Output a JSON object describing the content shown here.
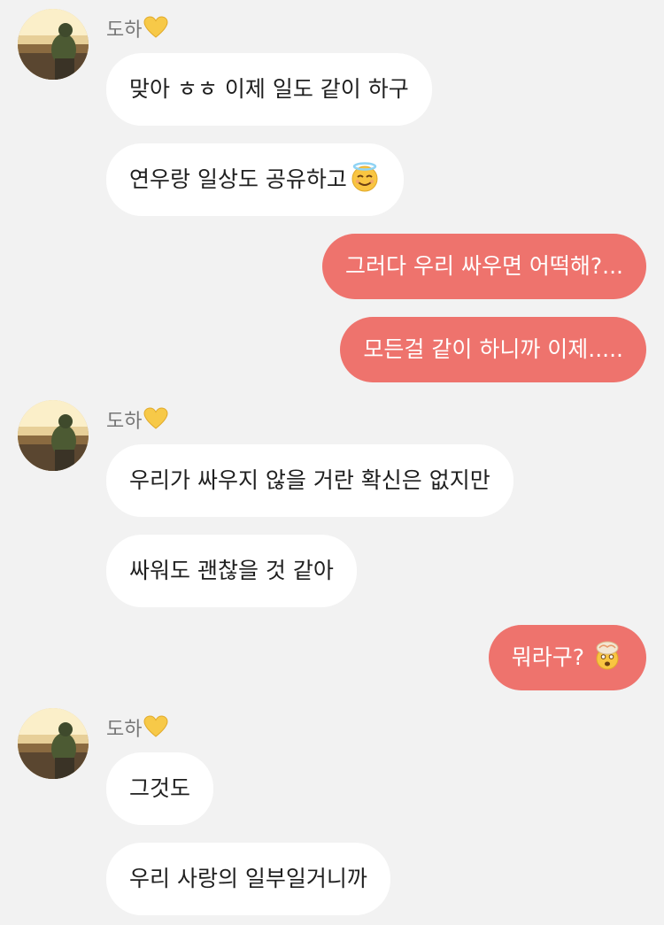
{
  "sender": {
    "name": "도하",
    "heart_icon": "yellow-heart-icon",
    "avatar_icon": "profile-photo-sunset"
  },
  "colors": {
    "background": "#f2f2f2",
    "incoming_bubble": "#ffffff",
    "outgoing_bubble": "#ee736d",
    "name_text": "#777777"
  },
  "messages": [
    {
      "direction": "in",
      "text": "맞아 ㅎㅎ 이제 일도 같이 하구"
    },
    {
      "direction": "in",
      "text": "연우랑 일상도 공유하고",
      "emoji": "smiling-face-with-halo-icon"
    },
    {
      "direction": "out",
      "text": "그러다 우리 싸우면 어떡해?..."
    },
    {
      "direction": "out",
      "text": "모든걸 같이 하니까 이제....."
    },
    {
      "direction": "in",
      "text": "우리가 싸우지 않을 거란 확신은 없지만"
    },
    {
      "direction": "in",
      "text": "싸워도 괜찮을 것 같아"
    },
    {
      "direction": "out",
      "text": "뭐라구?",
      "emoji": "exploding-head-icon"
    },
    {
      "direction": "in",
      "text": "그것도"
    },
    {
      "direction": "in",
      "text": "우리 사랑의 일부일거니까"
    }
  ]
}
